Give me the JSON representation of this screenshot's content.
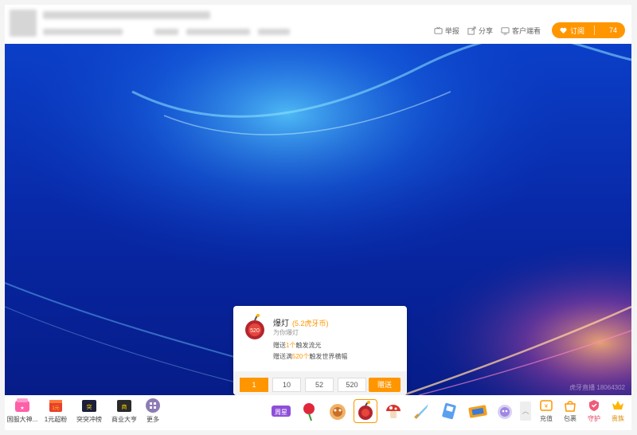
{
  "header": {
    "report_label": "举报",
    "share_label": "分享",
    "client_label": "客户端看",
    "subscribe_label": "订阅",
    "subscribe_count": "74"
  },
  "video": {
    "watermark": "虎牙直播 18064302"
  },
  "gift_popup": {
    "name": "爆灯",
    "price": "(5.2虎牙币)",
    "subtitle": "为你爆灯",
    "line1_pre": "赠送",
    "line1_hl": "1个",
    "line1_post": "触发流光",
    "line2_pre": "赠送满",
    "line2_hl": "520个",
    "line2_post": "触发世界横幅",
    "quantities": [
      "1",
      "10",
      "52",
      "520"
    ],
    "send_label": "赠送"
  },
  "bottom_left": [
    {
      "label": "国服大神...",
      "icon": "national-server-icon"
    },
    {
      "label": "1元超粉",
      "icon": "one-yuan-fan-icon"
    },
    {
      "label": "突突冲榜",
      "icon": "rank-rush-icon"
    },
    {
      "label": "商业大亨",
      "icon": "business-tycoon-icon"
    },
    {
      "label": "更多",
      "icon": "more-grid-icon"
    }
  ],
  "gift_bar": {
    "badge_text": "周星",
    "items": [
      "weekly-star-icon",
      "rose-icon",
      "cake-icon",
      "bomb-light-icon",
      "mushroom-icon",
      "sword-icon",
      "card-icon",
      "ticket-icon",
      "mascot-icon"
    ]
  },
  "bottom_right": [
    {
      "label": "充值",
      "icon": "recharge-icon"
    },
    {
      "label": "包裹",
      "icon": "package-icon"
    },
    {
      "label": "守护",
      "icon": "guard-icon"
    },
    {
      "label": "贵族",
      "icon": "noble-icon"
    }
  ],
  "colors": {
    "accent": "#ff9600",
    "video_bg": "#0a2aa8"
  }
}
